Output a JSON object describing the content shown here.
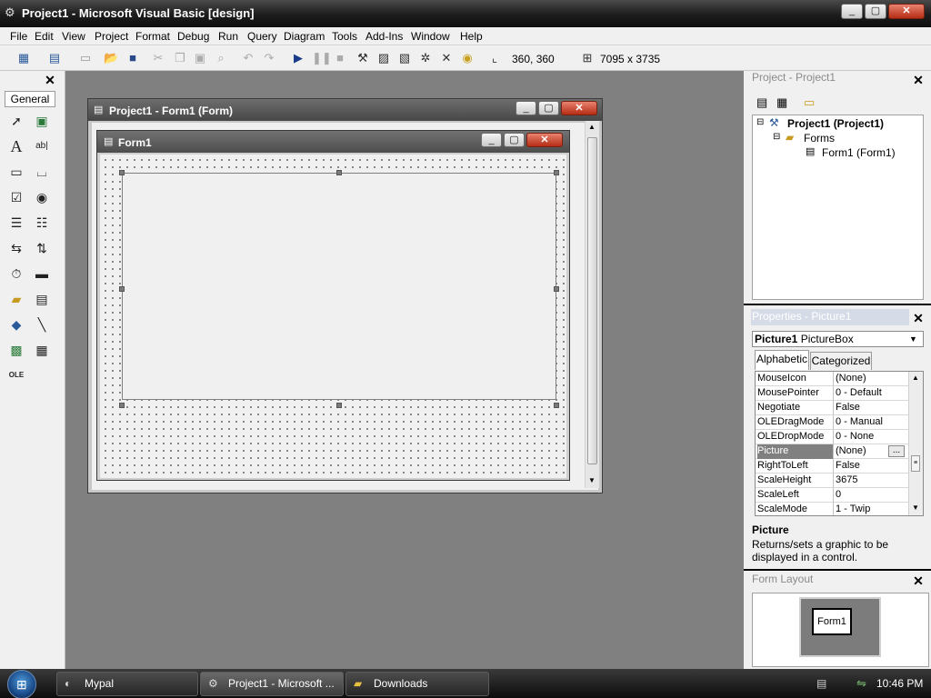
{
  "window": {
    "title": "Project1 - Microsoft Visual Basic [design]",
    "min": "_",
    "max": "▢",
    "close": "✕"
  },
  "menu": [
    "File",
    "Edit",
    "View",
    "Project",
    "Format",
    "Debug",
    "Run",
    "Query",
    "Diagram",
    "Tools",
    "Add-Ins",
    "Window",
    "Help"
  ],
  "toolbar": {
    "position": "360, 360",
    "size": "7095 x 3735"
  },
  "toolbox": {
    "tab_label": "General",
    "close": "✕"
  },
  "form_window": {
    "title": "Project1 - Form1 (Form)"
  },
  "form1": {
    "title": "Form1"
  },
  "project_explorer": {
    "title": "Project - Project1",
    "close": "✕",
    "root": "Project1 (Project1)",
    "folder": "Forms",
    "item": "Form1 (Form1)"
  },
  "properties": {
    "title": "Properties - Picture1",
    "close": "✕",
    "object": "Picture1",
    "object_type": "PictureBox",
    "tabs": [
      "Alphabetic",
      "Categorized"
    ],
    "rows": [
      {
        "name": "MouseIcon",
        "value": "(None)"
      },
      {
        "name": "MousePointer",
        "value": "0 - Default"
      },
      {
        "name": "Negotiate",
        "value": "False"
      },
      {
        "name": "OLEDragMode",
        "value": "0 - Manual"
      },
      {
        "name": "OLEDropMode",
        "value": "0 - None"
      },
      {
        "name": "Picture",
        "value": "(None)"
      },
      {
        "name": "RightToLeft",
        "value": "False"
      },
      {
        "name": "ScaleHeight",
        "value": "3675"
      },
      {
        "name": "ScaleLeft",
        "value": "0"
      },
      {
        "name": "ScaleMode",
        "value": "1 - Twip"
      }
    ],
    "selected_row": "Picture",
    "ellipsis": "...",
    "desc_title": "Picture",
    "desc_text": "Returns/sets a graphic to be displayed in a control."
  },
  "form_layout": {
    "title": "Form Layout",
    "close": "✕",
    "form_label": "Form1"
  },
  "taskbar": {
    "tasks": [
      "Mypal",
      "Project1 - Microsoft ...",
      "Downloads"
    ],
    "clock": "10:46 PM"
  }
}
